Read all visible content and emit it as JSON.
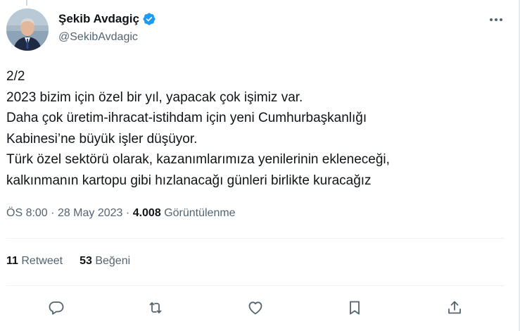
{
  "author": {
    "display_name": "Şekib Avdagiç",
    "handle": "@SekibAvdagic",
    "verified": true
  },
  "tweet": {
    "lines": [
      "2/2",
      "2023 bizim için özel bir yıl, yapacak çok işimiz var.",
      "Daha çok üretim-ihracat-istihdam için yeni Cumhurbaşkanlığı",
      "Kabinesi’ne büyük işler düşüyor.",
      "Türk özel sektörü olarak, kazanımlarımıza yenilerinin ekleneceği,",
      "kalkınmanın kartopu gibi hızlanacağı günleri birlikte kuracağız"
    ]
  },
  "meta": {
    "time": "ÖS 8:00",
    "separator": "·",
    "date": "28 May 2023",
    "views_count": "4.008",
    "views_label": "Görüntülenme"
  },
  "stats": {
    "retweets_count": "11",
    "retweets_label": "Retweet",
    "likes_count": "53",
    "likes_label": "Beğeni"
  },
  "colors": {
    "verified": "#1d9bf0",
    "secondary_text": "#536471",
    "primary_text": "#0f1419",
    "divider": "#eff3f4"
  },
  "icons": {
    "more": "more-horizontal-icon",
    "reply": "reply-icon",
    "retweet": "retweet-icon",
    "like": "heart-icon",
    "bookmark": "bookmark-icon",
    "share": "share-icon"
  }
}
